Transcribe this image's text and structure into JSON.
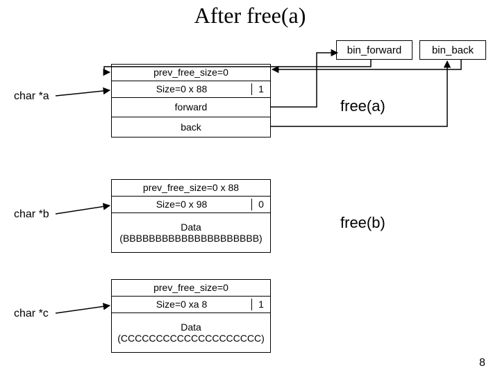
{
  "title": "After free(a)",
  "page_number": "8",
  "bins": {
    "forward": "bin_forward",
    "back": "bin_back"
  },
  "labels": {
    "ptr_a": "char *a",
    "ptr_b": "char *b",
    "ptr_c": "char *c",
    "free_a": "free(a)",
    "free_b": "free(b)"
  },
  "blocks": {
    "a": {
      "prev": "prev_free_size=0",
      "size": "Size=0 x 88",
      "flag": "1",
      "forward": "forward",
      "back": "back"
    },
    "b": {
      "prev": "prev_free_size=0 x 88",
      "size": "Size=0 x 98",
      "flag": "0",
      "data": "Data (BBBBBBBBBBBBBBBBBBBBB)"
    },
    "c": {
      "prev": "prev_free_size=0",
      "size": "Size=0 xa 8",
      "flag": "1",
      "data": "Data (CCCCCCCCCCCCCCCCCCCC)"
    }
  }
}
